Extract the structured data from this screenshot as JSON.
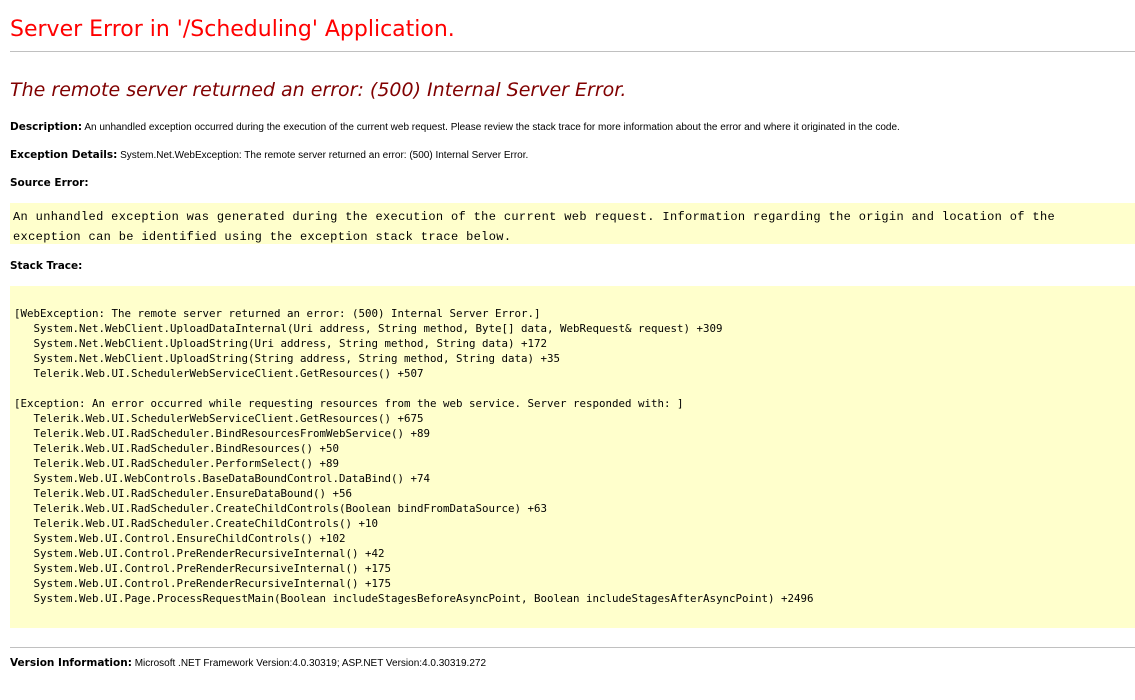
{
  "page": {
    "title": "Server Error in '/Scheduling' Application.",
    "error_message": "The remote server returned an error: (500) Internal Server Error."
  },
  "description": {
    "label": "Description:",
    "text": " An unhandled exception occurred during the execution of the current web request. Please review the stack trace for more information about the error and where it originated in the code."
  },
  "exception_details": {
    "label": "Exception Details:",
    "text": " System.Net.WebException: The remote server returned an error: (500) Internal Server Error."
  },
  "source_error": {
    "label": "Source Error:",
    "text": "An unhandled exception was generated during the execution of the current web request. Information regarding the origin and location of the\nexception can be identified using the exception stack trace below."
  },
  "stack_trace": {
    "label": "Stack Trace:",
    "text": "[WebException: The remote server returned an error: (500) Internal Server Error.]\n   System.Net.WebClient.UploadDataInternal(Uri address, String method, Byte[] data, WebRequest& request) +309\n   System.Net.WebClient.UploadString(Uri address, String method, String data) +172\n   System.Net.WebClient.UploadString(String address, String method, String data) +35\n   Telerik.Web.UI.SchedulerWebServiceClient.GetResources() +507\n\n[Exception: An error occurred while requesting resources from the web service. Server responded with: ]\n   Telerik.Web.UI.SchedulerWebServiceClient.GetResources() +675\n   Telerik.Web.UI.RadScheduler.BindResourcesFromWebService() +89\n   Telerik.Web.UI.RadScheduler.BindResources() +50\n   Telerik.Web.UI.RadScheduler.PerformSelect() +89\n   System.Web.UI.WebControls.BaseDataBoundControl.DataBind() +74\n   Telerik.Web.UI.RadScheduler.EnsureDataBound() +56\n   Telerik.Web.UI.RadScheduler.CreateChildControls(Boolean bindFromDataSource) +63\n   Telerik.Web.UI.RadScheduler.CreateChildControls() +10\n   System.Web.UI.Control.EnsureChildControls() +102\n   System.Web.UI.Control.PreRenderRecursiveInternal() +42\n   System.Web.UI.Control.PreRenderRecursiveInternal() +175\n   System.Web.UI.Control.PreRenderRecursiveInternal() +175\n   System.Web.UI.Page.ProcessRequestMain(Boolean includeStagesBeforeAsyncPoint, Boolean includeStagesAfterAsyncPoint) +2496"
  },
  "version_info": {
    "label": "Version Information:",
    "text": " Microsoft .NET Framework Version:4.0.30319; ASP.NET Version:4.0.30319.272"
  },
  "colors": {
    "title": "#ff0000",
    "error_message": "#800000",
    "code_background": "#ffffcc",
    "rule": "#c0c0c0"
  }
}
